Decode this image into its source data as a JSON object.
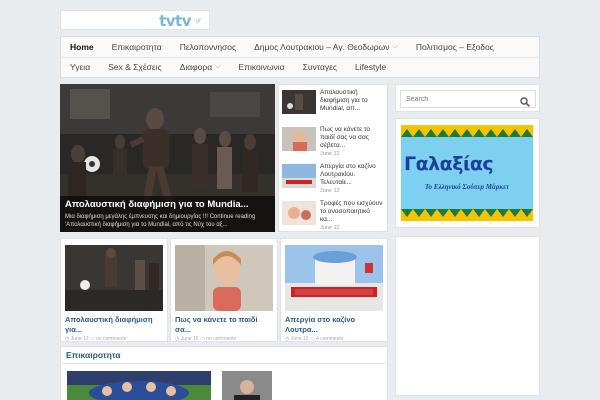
{
  "site": {
    "logo_text": "tvtv",
    "logo_suffix": ".gr"
  },
  "nav": {
    "row1": [
      {
        "label": "Home",
        "active": true,
        "dropdown": false
      },
      {
        "label": "Επικαιροτητα",
        "dropdown": false
      },
      {
        "label": "Πελοποννησος",
        "dropdown": false
      },
      {
        "label": "Δημος Λουτρακιου – Αγ. Θεοδωρων",
        "dropdown": true
      },
      {
        "label": "Πολιτισμος – Εξοδος",
        "dropdown": false
      }
    ],
    "row2": [
      {
        "label": "Υγεια",
        "dropdown": false
      },
      {
        "label": "Sex & Σχέσεις",
        "dropdown": false
      },
      {
        "label": "Διαφορα",
        "dropdown": true
      },
      {
        "label": "Επικοινωνια",
        "dropdown": false
      },
      {
        "label": "Συνταγες",
        "dropdown": false
      },
      {
        "label": "Lifestyle",
        "dropdown": false
      }
    ]
  },
  "hero": {
    "title": "Απολαυστική διαφήμιση για το Mundia...",
    "description": "Μια διαφήμιση μεγάλης έμπνευσης και δημιουργίας !!! Continue reading 'Απολαυστική διαφήμιση για το Mundial, από τις Νύχ του αξ..."
  },
  "slider_list": [
    {
      "title": "Απολαυστική διαφήμιση για το Mundial, απ...",
      "date": "June 12"
    },
    {
      "title": "Πως να κάνετε το παιδί σας να σας σέβετα...",
      "date": "June 12"
    },
    {
      "title": "Απεργία στο καζίνο Λουτρακίου. Τελευταίε...",
      "date": "June 12"
    },
    {
      "title": "Τροφές που εισχύουν το ανοσοποιητικό κα...",
      "date": "June 12"
    }
  ],
  "cards": [
    {
      "title": "Απολαυστική διαφήμιση για...",
      "date": "June 12",
      "comments": "no comments"
    },
    {
      "title": "Πως να κάνετε το παιδί σα...",
      "date": "June 12",
      "comments": "no comments"
    },
    {
      "title": "Απεργία στο καζίνο Λουτρα...",
      "date": "June 12",
      "comments": "4 comments"
    }
  ],
  "section": {
    "title": "Επικαιροτητα"
  },
  "search": {
    "placeholder": "Search"
  },
  "ad": {
    "name": "Γαλαξίας",
    "tagline": "Το Ελληνικό Σούπερ Μάρκετ"
  },
  "colors": {
    "link_blue": "#2c5a86",
    "background": "#e9ecee",
    "ad_sky": "#7dd0f0",
    "ad_text": "#1d3f9a"
  }
}
